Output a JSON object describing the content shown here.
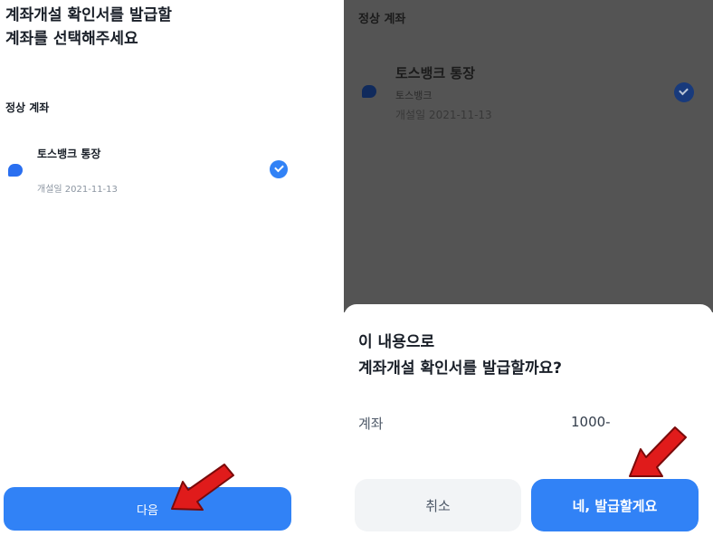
{
  "left": {
    "title_line1": "계좌개설 확인서를 발급할",
    "title_line2": "계좌를 선택해주세요",
    "section_label": "정상 계좌",
    "account": {
      "name": "토스뱅크 통장",
      "opened_date": "개설일 2021-11-13",
      "selected": true
    },
    "next_label": "다음"
  },
  "right": {
    "section_label": "정상 계좌",
    "account": {
      "name": "토스뱅크 통장",
      "bank": "토스뱅크",
      "opened_date": "개설일 2021-11-13",
      "selected": true
    },
    "sheet": {
      "title_line1": "이 내용으로",
      "title_line2": "계좌개설 확인서를 발급할까요?",
      "row_label": "계좌",
      "row_value": "1000-",
      "cancel_label": "취소",
      "confirm_label": "네, 발급할게요"
    }
  },
  "colors": {
    "primary": "#3182f6",
    "arrow": "#e01b1b",
    "overlay": "#545454"
  },
  "icons": [
    "toss-bank-icon",
    "check-icon",
    "pointer-arrow"
  ]
}
